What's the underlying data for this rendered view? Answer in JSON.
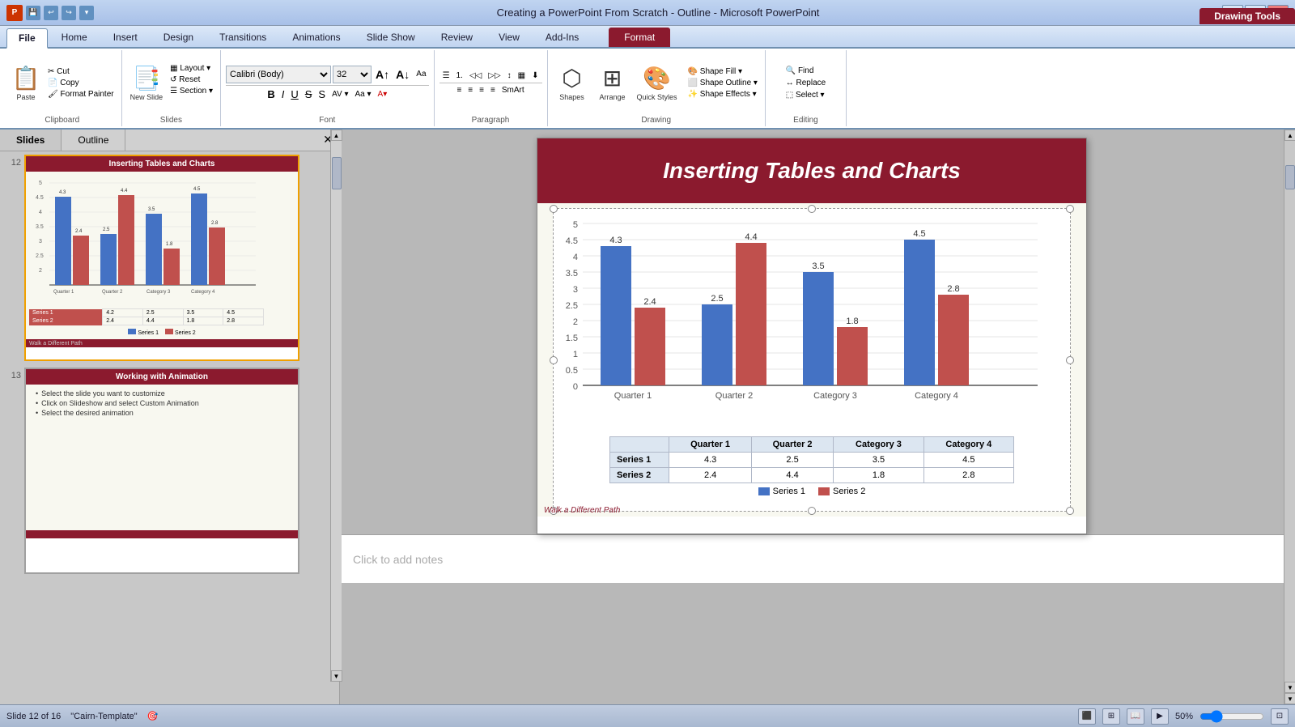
{
  "titlebar": {
    "title": "Creating a PowerPoint From Scratch - Outline - Microsoft PowerPoint",
    "drawing_tools_label": "Drawing Tools",
    "minimize": "−",
    "restore": "❐",
    "close": "✕"
  },
  "ribbon": {
    "tabs": [
      "File",
      "Home",
      "Insert",
      "Design",
      "Transitions",
      "Animations",
      "Slide Show",
      "Review",
      "View",
      "Add-Ins",
      "Format"
    ],
    "active_tab": "Home",
    "groups": {
      "clipboard": {
        "label": "Clipboard",
        "paste_label": "Paste"
      },
      "slides": {
        "label": "Slides",
        "new_slide_label": "New\nSlide",
        "layout_label": "Layout",
        "reset_label": "Reset",
        "section_label": "Section"
      },
      "font": {
        "label": "Font",
        "font_name": "Calibri (Body)",
        "font_size": "32"
      },
      "paragraph": {
        "label": "Paragraph"
      },
      "drawing": {
        "label": "Drawing",
        "shapes_label": "Shapes",
        "arrange_label": "Arrange",
        "quick_styles_label": "Quick\nStyles",
        "shape_fill_label": "Shape Fill",
        "shape_outline_label": "Shape Outline",
        "shape_effects_label": "Shape Effects"
      },
      "editing": {
        "label": "Editing",
        "find_label": "Find",
        "replace_label": "Replace",
        "select_label": "Select ▾"
      }
    }
  },
  "panel": {
    "tabs": [
      "Slides",
      "Outline"
    ],
    "active_tab": "Slides",
    "slides": [
      {
        "number": "12",
        "title": "Inserting Tables and Charts",
        "active": true,
        "chart_data": {
          "series1": [
            4.3,
            2.5,
            3.5,
            4.5
          ],
          "series2": [
            2.4,
            4.4,
            1.8,
            2.8
          ],
          "categories": [
            "Quarter 1",
            "Quarter 2",
            "Category 3",
            "Category 4"
          ]
        }
      },
      {
        "number": "13",
        "title": "Working with Animation",
        "active": false,
        "bullets": [
          "Select the slide you want to customize",
          "Click on Slideshow and select Custom Animation",
          "Select the desired animation"
        ]
      }
    ]
  },
  "main_slide": {
    "title": "Inserting Tables and Charts",
    "chart": {
      "y_axis_labels": [
        "5",
        "4.5",
        "4",
        "3.5",
        "3",
        "2.5",
        "2",
        "1.5",
        "1",
        "0.5",
        "0"
      ],
      "categories": [
        "Quarter 1",
        "Quarter 2",
        "Category 3",
        "Category 4"
      ],
      "series1_label": "Series 1",
      "series2_label": "Series 2",
      "series1_values": [
        4.3,
        2.5,
        3.5,
        4.5
      ],
      "series2_values": [
        2.4,
        4.4,
        1.8,
        2.8
      ],
      "series1_color": "#4472c4",
      "series2_color": "#c0504d",
      "table": {
        "headers": [
          "",
          "Quarter 1",
          "Quarter 2",
          "Category 3",
          "Category 4"
        ],
        "rows": [
          [
            "Series 1",
            "4.3",
            "2.5",
            "3.5",
            "4.5"
          ],
          [
            "Series 2",
            "2.4",
            "4.4",
            "1.8",
            "2.8"
          ]
        ]
      },
      "legend": [
        "Series 1",
        "Series 2"
      ],
      "footer_text": "Walk a Different Path"
    }
  },
  "notes": {
    "placeholder": "Click to add notes"
  },
  "statusbar": {
    "slide_info": "Slide 12 of 16",
    "template": "\"Cairn-Template\"",
    "zoom": "50%"
  }
}
